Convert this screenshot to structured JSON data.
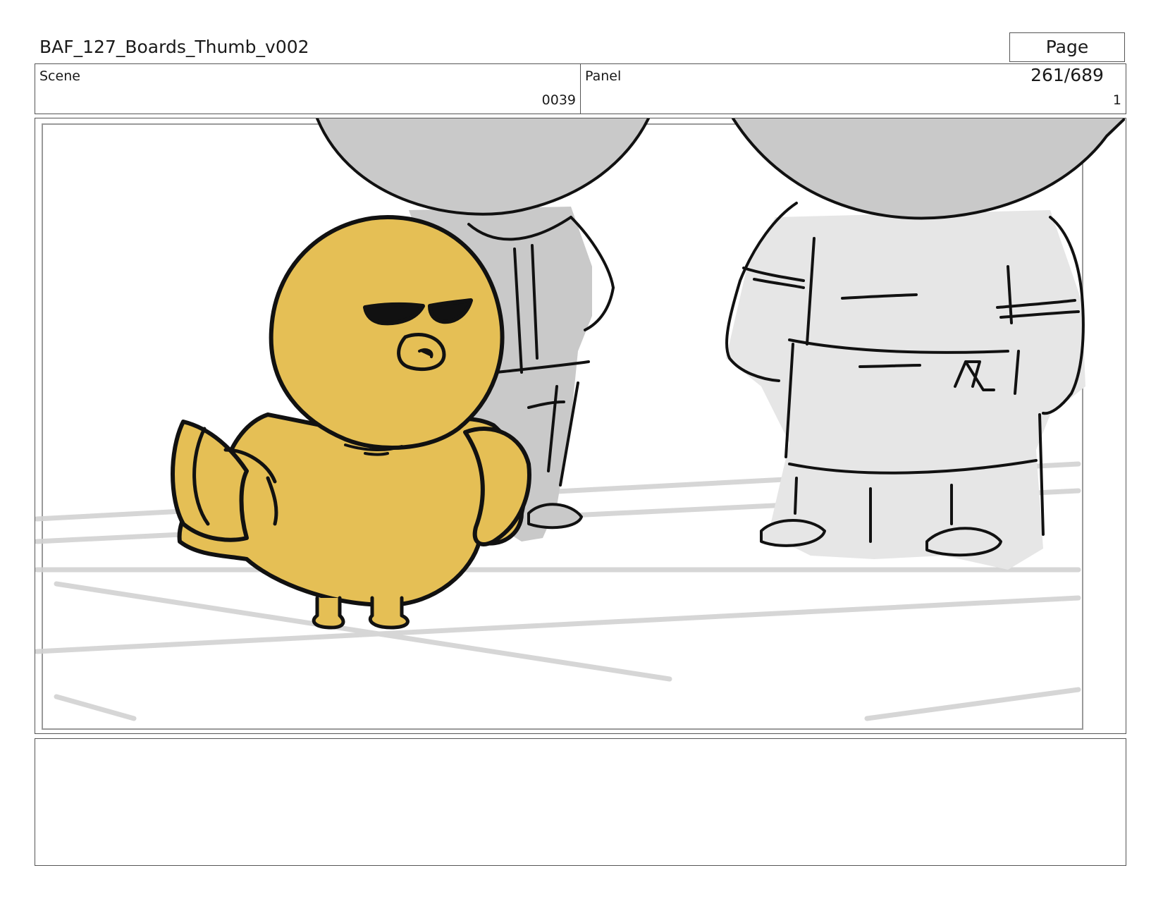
{
  "header": {
    "document_title": "BAF_127_Boards_Thumb_v002",
    "page_indicator": "Page 261/689"
  },
  "info": {
    "scene_label": "Scene",
    "scene_value": "0039",
    "panel_label": "Panel",
    "panel_value": "1"
  },
  "panel": {
    "description": "",
    "colors": {
      "duck_body": "#e5bf55",
      "character_gray": "#c9c9c9",
      "character_light_gray": "#e6e6e6",
      "outline": "#111111",
      "floor_lines": "#cfcfcf"
    }
  },
  "notes": {
    "text": ""
  }
}
